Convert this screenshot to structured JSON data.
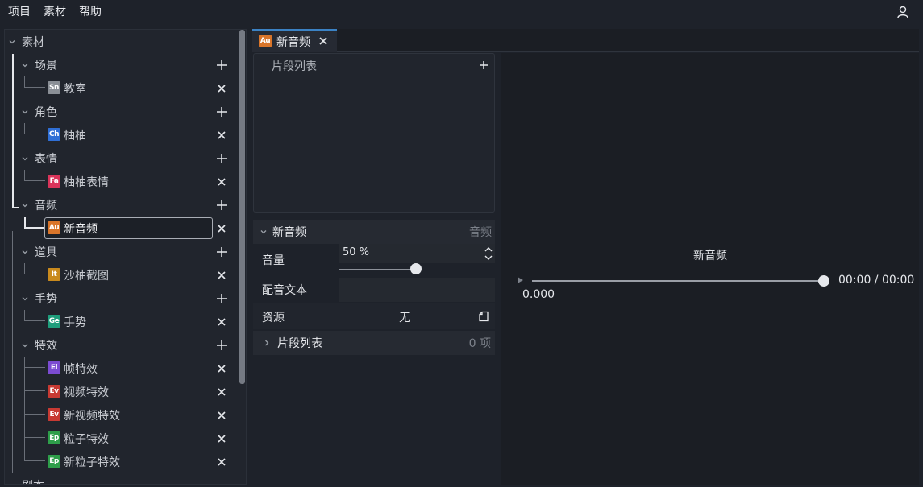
{
  "menu": {
    "project": "项目",
    "assets": "素材",
    "help": "帮助"
  },
  "tree": {
    "root_label": "素材",
    "categories": {
      "scene": {
        "label": "场景",
        "items": [
          {
            "badge": "Sn",
            "label": "教室"
          }
        ]
      },
      "character": {
        "label": "角色",
        "items": [
          {
            "badge": "Ch",
            "label": "柚柚"
          }
        ]
      },
      "expression": {
        "label": "表情",
        "items": [
          {
            "badge": "Fa",
            "label": "柚柚表情"
          }
        ]
      },
      "audio": {
        "label": "音频",
        "items": [
          {
            "badge": "Au",
            "label": "新音频"
          }
        ]
      },
      "prop": {
        "label": "道具",
        "items": [
          {
            "badge": "It",
            "label": "沙柚截图"
          }
        ]
      },
      "gesture": {
        "label": "手势",
        "items": [
          {
            "badge": "Ge",
            "label": "手势"
          }
        ]
      },
      "effects": {
        "label": "特效",
        "items": [
          {
            "badge": "Ei",
            "label": "帧特效"
          },
          {
            "badge": "Ev",
            "label": "视频特效"
          },
          {
            "badge": "Ev",
            "label": "新视频特效"
          },
          {
            "badge": "Ep",
            "label": "粒子特效"
          },
          {
            "badge": "Ep",
            "label": "新粒子特效"
          }
        ]
      },
      "script": {
        "label": "剧本"
      }
    },
    "selected_item": "新音频"
  },
  "tab": {
    "badge": "Au",
    "title": "新音频"
  },
  "clip_list": {
    "title": "片段列表"
  },
  "properties": {
    "name": "新音频",
    "type": "音频",
    "volume_label": "音量",
    "volume_value": "50 %",
    "volume_level": 0.5,
    "voice_text_label": "配音文本",
    "voice_text_value": "",
    "resource_label": "资源",
    "resource_value": "无",
    "clips_label": "片段列表",
    "clips_count": "0 项"
  },
  "preview": {
    "title": "新音频",
    "time": "00:00 / 00:00",
    "position": "0.000"
  },
  "colors": {
    "badge_Sn": "#8a8f96",
    "badge_Ch": "#2f6fd6",
    "badge_Fa": "#d9345a",
    "badge_Au": "#d9752a",
    "badge_It": "#c98a1d",
    "badge_Ge": "#1e9e7c",
    "badge_Ei": "#7b4bd1",
    "badge_Ev": "#c83a33",
    "badge_Ep": "#2e9e4a",
    "tab_accent": "#3b82c4"
  }
}
